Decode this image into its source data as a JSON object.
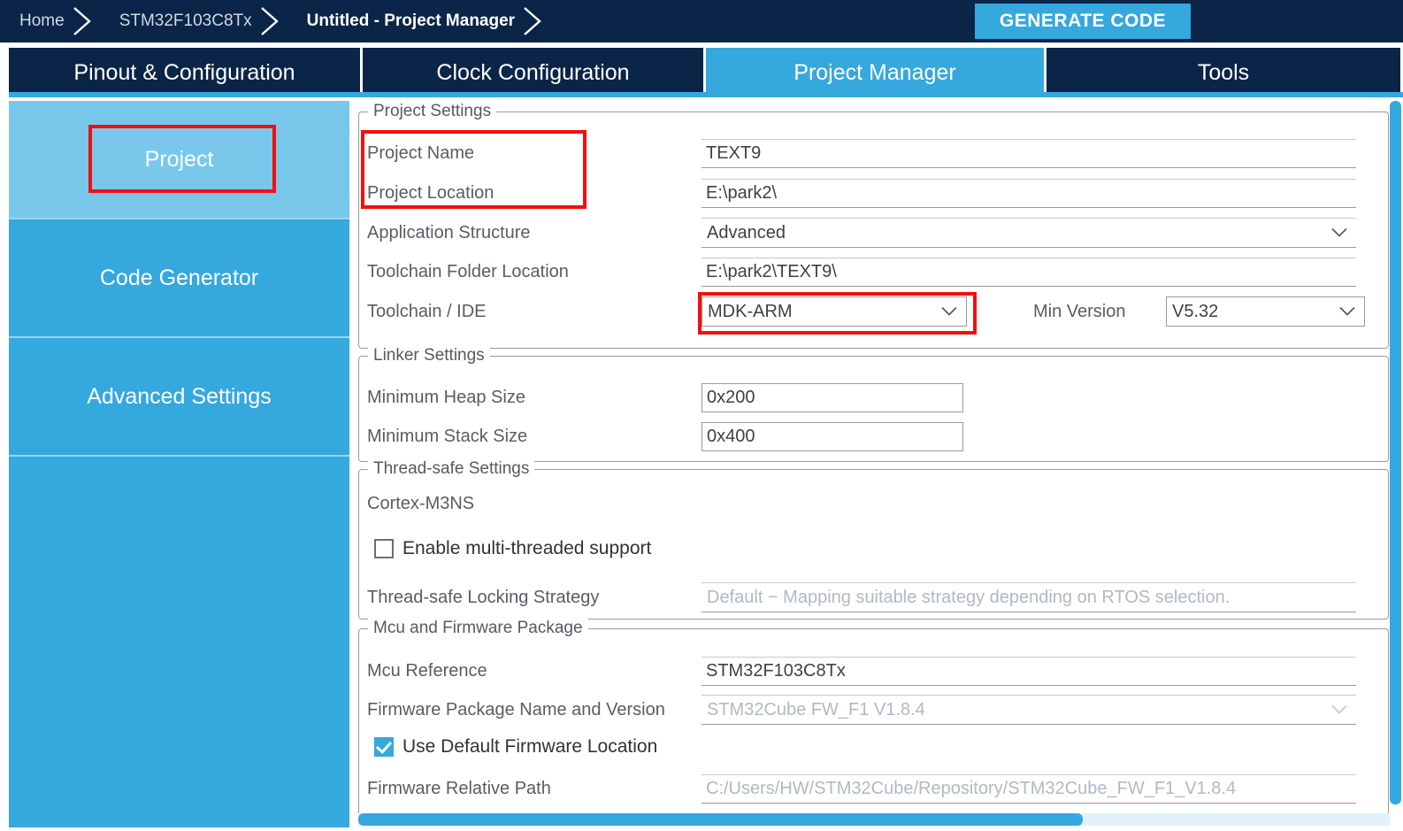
{
  "topbar": {
    "breadcrumbs": [
      {
        "label": "Home",
        "active": false
      },
      {
        "label": "STM32F103C8Tx",
        "active": false
      },
      {
        "label": "Untitled - Project Manager",
        "active": true
      }
    ],
    "generate_code_label": "GENERATE CODE"
  },
  "tabs": [
    {
      "label": "Pinout & Configuration",
      "active": false
    },
    {
      "label": "Clock Configuration",
      "active": false
    },
    {
      "label": "Project Manager",
      "active": true
    },
    {
      "label": "Tools",
      "active": false
    }
  ],
  "sidebar": {
    "items": [
      {
        "label": "Project",
        "selected": true
      },
      {
        "label": "Code Generator",
        "selected": false
      },
      {
        "label": "Advanced Settings",
        "selected": false
      }
    ]
  },
  "project_settings": {
    "group_title": "Project Settings",
    "project_name_label": "Project Name",
    "project_name_value": "TEXT9",
    "project_location_label": "Project Location",
    "project_location_value": "E:\\park2\\",
    "application_structure_label": "Application Structure",
    "application_structure_value": "Advanced",
    "toolchain_folder_label": "Toolchain Folder Location",
    "toolchain_folder_value": "E:\\park2\\TEXT9\\",
    "toolchain_ide_label": "Toolchain / IDE",
    "toolchain_ide_value": "MDK-ARM",
    "min_version_label": "Min Version",
    "min_version_value": "V5.32"
  },
  "linker_settings": {
    "group_title": "Linker Settings",
    "min_heap_label": "Minimum Heap Size",
    "min_heap_value": "0x200",
    "min_stack_label": "Minimum Stack Size",
    "min_stack_value": "0x400"
  },
  "thread_safe_settings": {
    "group_title": "Thread-safe Settings",
    "cortex_label": "Cortex-M3NS",
    "enable_multithread_label": "Enable multi-threaded support",
    "enable_multithread_checked": false,
    "locking_strategy_label": "Thread-safe Locking Strategy",
    "locking_strategy_value": "Default  −  Mapping suitable strategy depending on RTOS selection."
  },
  "mcu_firmware": {
    "group_title": "Mcu and Firmware Package",
    "mcu_reference_label": "Mcu Reference",
    "mcu_reference_value": "STM32F103C8Tx",
    "firmware_package_label": "Firmware Package Name and Version",
    "firmware_package_value": "STM32Cube FW_F1 V1.8.4",
    "use_default_fw_label": "Use Default Firmware Location",
    "use_default_fw_checked": true,
    "firmware_relative_path_label": "Firmware Relative Path",
    "firmware_relative_path_value": "C:/Users/HW/STM32Cube/Repository/STM32Cube_FW_F1_V1.8.4"
  },
  "colors": {
    "navy": "#0b2548",
    "accent_blue": "#35a8de",
    "selected_blue": "#79c8ec",
    "annotation_red": "#f40f0f"
  }
}
